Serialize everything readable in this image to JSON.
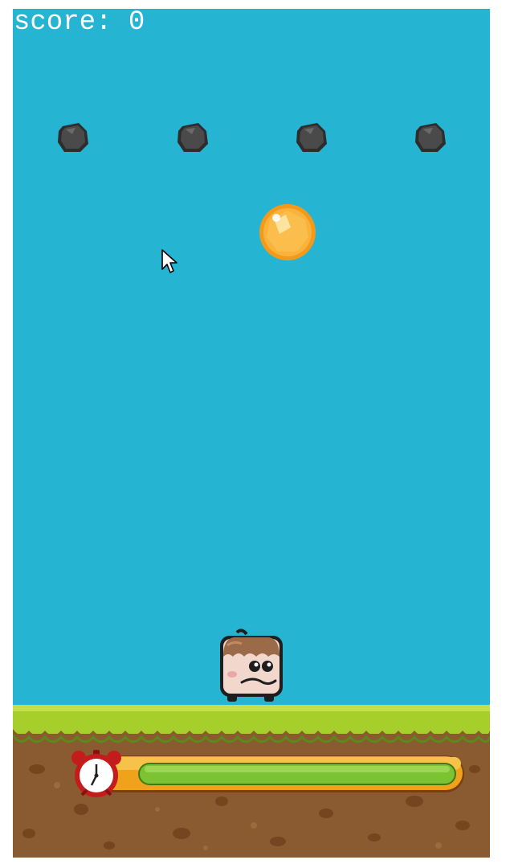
{
  "hud": {
    "score_label": "score: 0"
  },
  "timer": {
    "remaining_fraction": 1.0
  },
  "colors": {
    "sky": "#26b4d3",
    "grass": "#a7cf2c",
    "dirt": "#8a5a30",
    "timer_fill": "#7cc334",
    "timer_frame": "#f0a21a"
  },
  "icons": {
    "rock": "rock-icon",
    "coin": "coin-icon",
    "player": "player-character",
    "clock": "alarm-clock-icon",
    "cursor": "mouse-pointer-icon"
  }
}
